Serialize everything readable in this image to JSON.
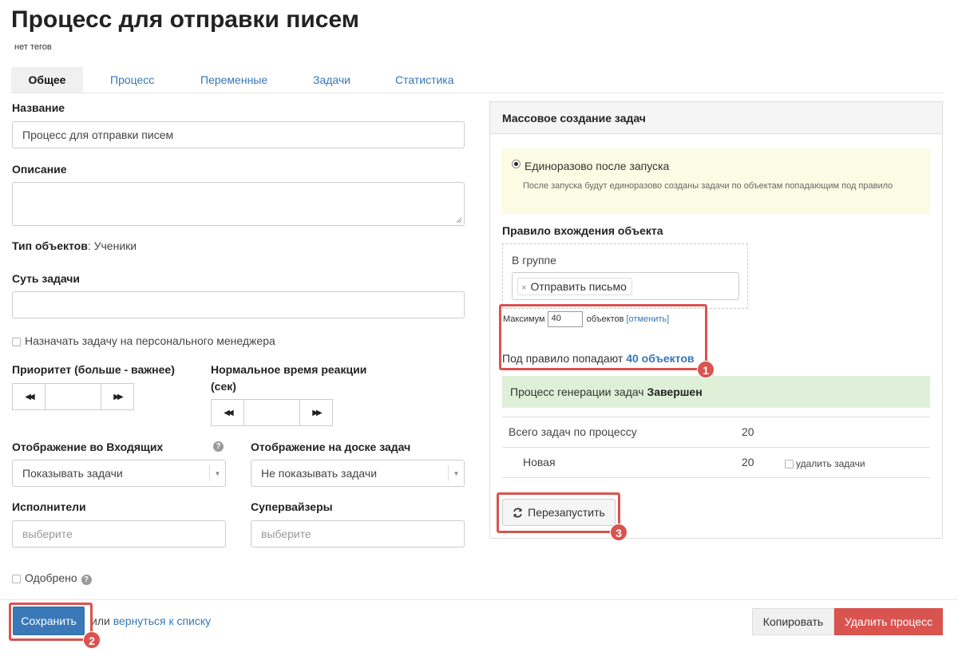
{
  "page": {
    "title": "Процесс для отправки писем",
    "tags": "нет тегов"
  },
  "tabs": [
    {
      "label": "Общее"
    },
    {
      "label": "Процесс"
    },
    {
      "label": "Переменные"
    },
    {
      "label": "Задачи"
    },
    {
      "label": "Статистика"
    }
  ],
  "form": {
    "name_label": "Название",
    "name_value": "Процесс для отправки писем",
    "description_label": "Описание",
    "object_type_label": "Тип объектов",
    "object_type_value": ": Ученики",
    "task_essence_label": "Суть задачи",
    "assign_personal_manager_label": "Назначать задачу на персонального менеджера",
    "priority_label": "Приоритет (больше - важнее)",
    "reaction_time_label_line1": "Нормальное время реакции",
    "reaction_time_label_line2": "(сек)",
    "inbox_display_label": "Отображение во Входящих",
    "inbox_display_value": "Показывать задачи",
    "board_display_label": "Отображение на доске задач",
    "board_display_value": "Не показывать задачи",
    "performers_label": "Исполнители",
    "performers_placeholder": "выберите",
    "supervisors_label": "Супервайзеры",
    "supervisors_placeholder": "выберите",
    "approved_label": "Одобрено",
    "help_glyph": "?"
  },
  "stepper_icons": {
    "prev": "rewind-icon",
    "next": "fast-forward-icon"
  },
  "mass_panel": {
    "title": "Массовое создание задач",
    "option_label": "Единоразово после запуска",
    "option_hint": "После запуска будут единоразово созданы задачи по объектам попадающим под правило",
    "rule_label": "Правило вхождения объекта",
    "group_label": "В группе",
    "group_tag": "Отправить письмо",
    "tag_remove_glyph": "×",
    "max_prefix": "Максимум",
    "max_value": "40",
    "max_suffix": "объектов",
    "cancel_link": "[отменить]",
    "match_prefix": "Под правило попадают",
    "match_link": "40 объектов",
    "status_prefix": "Процесс генерации задач",
    "status_value": "Завершен",
    "stats": [
      {
        "label": "Всего задач по процессу",
        "value": "20"
      },
      {
        "label": "Новая",
        "value": "20",
        "action": "удалить задачи"
      }
    ],
    "restart_label": "Перезапустить"
  },
  "footer": {
    "save_label": "Сохранить",
    "or_text": "или",
    "back_link": "вернуться к списку",
    "copy_label": "Копировать",
    "delete_label": "Удалить процесс"
  },
  "badges": [
    "1",
    "2",
    "3"
  ],
  "colors": {
    "primary": "#3a79b8",
    "danger": "#d9534f",
    "link": "#3576b8",
    "success_bg": "#dff0d8",
    "warning_bg": "#fcfbe3"
  }
}
